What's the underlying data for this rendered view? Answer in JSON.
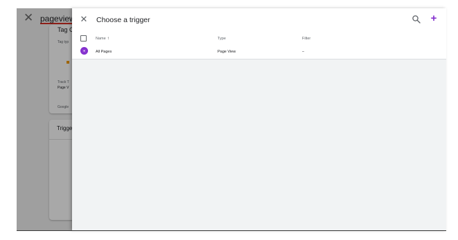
{
  "background_editor": {
    "title": "pageview",
    "close_icon": "close-icon",
    "tag_card": {
      "header": "Tag C",
      "type_label": "Tag typ",
      "track_type_label": "Track T",
      "track_type_value": "Page V",
      "footer_label": "Google"
    },
    "triggering_card": {
      "title": "Trigge"
    },
    "warning_icon": "warning-icon"
  },
  "panel": {
    "title": "Choose a trigger",
    "close_icon": "close-icon",
    "search_icon": "search-icon",
    "add_icon": "add-icon",
    "accent_color": "#8430ce",
    "columns": {
      "name": "Name",
      "type": "Type",
      "filter": "Filter",
      "sort_indicator": "↑"
    },
    "rows": [
      {
        "icon": "pageview-trigger-icon",
        "name": "All Pages",
        "type": "Page View",
        "filter": "–"
      }
    ]
  }
}
